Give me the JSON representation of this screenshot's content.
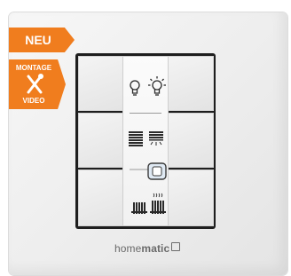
{
  "badges": {
    "new_label": "NEU",
    "assembly_line1": "MONTAGE",
    "assembly_line2": "VIDEO",
    "assembly_icon": "wrench-screwdriver-icon",
    "color": "#f07d1e"
  },
  "device": {
    "brand_regular": "home",
    "brand_bold": "matic",
    "icons": [
      "bulb-off-icon",
      "bulb-on-icon",
      "blinds-closed-icon",
      "blinds-open-icon",
      "center-button-icon",
      "radiator-icon",
      "radiator-heat-icon"
    ]
  }
}
